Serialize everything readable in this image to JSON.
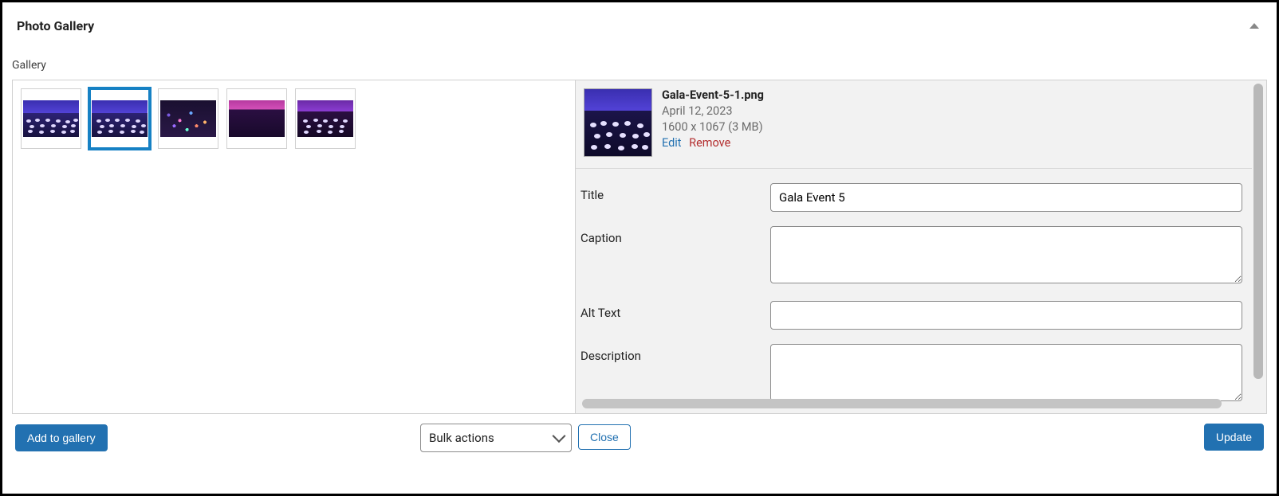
{
  "panel": {
    "title": "Photo Gallery"
  },
  "section": {
    "label": "Gallery"
  },
  "leftFooter": {
    "addButton": "Add to gallery",
    "bulkSelectLabel": "Bulk actions"
  },
  "rightFooter": {
    "closeButton": "Close",
    "updateButton": "Update"
  },
  "attachment": {
    "filename": "Gala-Event-5-1.png",
    "date": "April 12, 2023",
    "size": "1600 x 1067 (3 MB)",
    "editLink": "Edit",
    "removeLink": "Remove"
  },
  "fields": {
    "titleLabel": "Title",
    "titleValue": "Gala Event 5",
    "captionLabel": "Caption",
    "captionValue": "",
    "altLabel": "Alt Text",
    "altValue": "",
    "descLabel": "Description",
    "descValue": ""
  }
}
